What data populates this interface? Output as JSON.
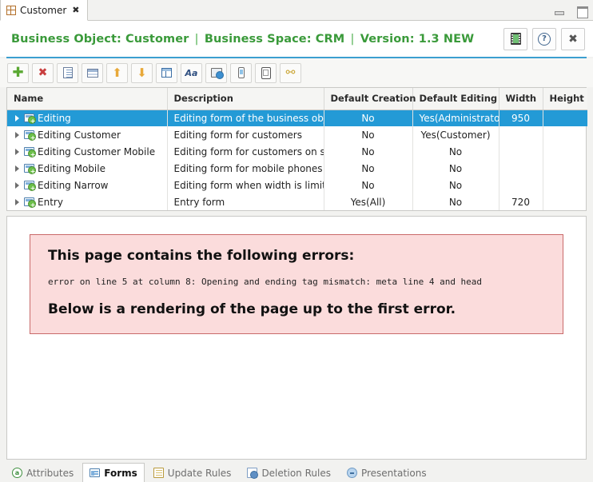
{
  "window": {
    "tab": {
      "label": "Customer",
      "icon": "grid-icon",
      "close_glyph": "✖"
    },
    "controls": {
      "minimize": "minimize-icon",
      "maximize": "maximize-icon"
    }
  },
  "banner": {
    "business_object_label": "Business Object: Customer",
    "business_space_label": "Business Space: CRM",
    "version_label": "Version: 1.3 NEW",
    "separator": "|",
    "accent_color": "#3c9fd0",
    "text_color": "#3a9a3a",
    "buttons": [
      {
        "name": "film-button",
        "icon": "film-icon",
        "title": "Film"
      },
      {
        "name": "help-button",
        "icon": "help-icon",
        "title": "?"
      },
      {
        "name": "close-button",
        "icon": "close-icon",
        "title": "✖"
      }
    ]
  },
  "toolbar": {
    "buttons": [
      {
        "name": "add-button",
        "icon": "plus-icon"
      },
      {
        "name": "delete-button",
        "icon": "red-x-icon"
      },
      {
        "name": "document-button",
        "icon": "document-icon"
      },
      {
        "name": "table-button",
        "icon": "table-icon"
      },
      {
        "name": "move-up-button",
        "icon": "arrow-up-icon"
      },
      {
        "name": "move-down-button",
        "icon": "arrow-down-icon"
      },
      {
        "name": "layout-button",
        "icon": "layout-icon"
      },
      {
        "name": "font-button",
        "icon": "font-aa-icon"
      },
      {
        "name": "web-preview-button",
        "icon": "web-icon"
      },
      {
        "name": "phone-preview-button",
        "icon": "phone-icon"
      },
      {
        "name": "tablet-preview-button",
        "icon": "tablet-icon"
      },
      {
        "name": "link-button",
        "icon": "link-icon"
      }
    ]
  },
  "table": {
    "columns": [
      {
        "label": "Name",
        "align": "left"
      },
      {
        "label": "Description",
        "align": "left"
      },
      {
        "label": "Default Creation",
        "align": "center"
      },
      {
        "label": "Default Editing",
        "align": "center"
      },
      {
        "label": "Width",
        "align": "center"
      },
      {
        "label": "Height",
        "align": "center"
      }
    ],
    "rows": [
      {
        "name": "Editing",
        "description": "Editing form of the business objec",
        "default_creation": "No",
        "default_editing": "Yes(Administrator,S",
        "width": "950",
        "height": "",
        "selected": true
      },
      {
        "name": "Editing Customer",
        "description": "Editing form for customers",
        "default_creation": "No",
        "default_editing": "Yes(Customer)",
        "width": "",
        "height": "",
        "selected": false
      },
      {
        "name": "Editing Customer Mobile",
        "description": "Editing form for customers on sm",
        "default_creation": "No",
        "default_editing": "No",
        "width": "",
        "height": "",
        "selected": false
      },
      {
        "name": "Editing Mobile",
        "description": "Editing form for mobile phones",
        "default_creation": "No",
        "default_editing": "No",
        "width": "",
        "height": "",
        "selected": false
      },
      {
        "name": "Editing Narrow",
        "description": "Editing form when width is limitec",
        "default_creation": "No",
        "default_editing": "No",
        "width": "",
        "height": "",
        "selected": false
      },
      {
        "name": "Entry",
        "description": "Entry form",
        "default_creation": "Yes(All)",
        "default_editing": "No",
        "width": "720",
        "height": "",
        "selected": false
      }
    ],
    "selection_color": "#239ad6"
  },
  "preview": {
    "error_title": "This page contains the following errors:",
    "error_message": "error on line 5 at column 8: Opening and ending tag mismatch: meta line 4 and head",
    "error_footer": "Below is a rendering of the page up to the first error.",
    "box_background": "#fbdcdc",
    "box_border": "#c96a6a"
  },
  "bottom_tabs": [
    {
      "label": "Attributes",
      "icon": "attributes-icon",
      "active": false
    },
    {
      "label": "Forms",
      "icon": "forms-icon",
      "active": true
    },
    {
      "label": "Update Rules",
      "icon": "update-rules-icon",
      "active": false
    },
    {
      "label": "Deletion Rules",
      "icon": "deletion-rules-icon",
      "active": false
    },
    {
      "label": "Presentations",
      "icon": "presentations-icon",
      "active": false
    }
  ]
}
